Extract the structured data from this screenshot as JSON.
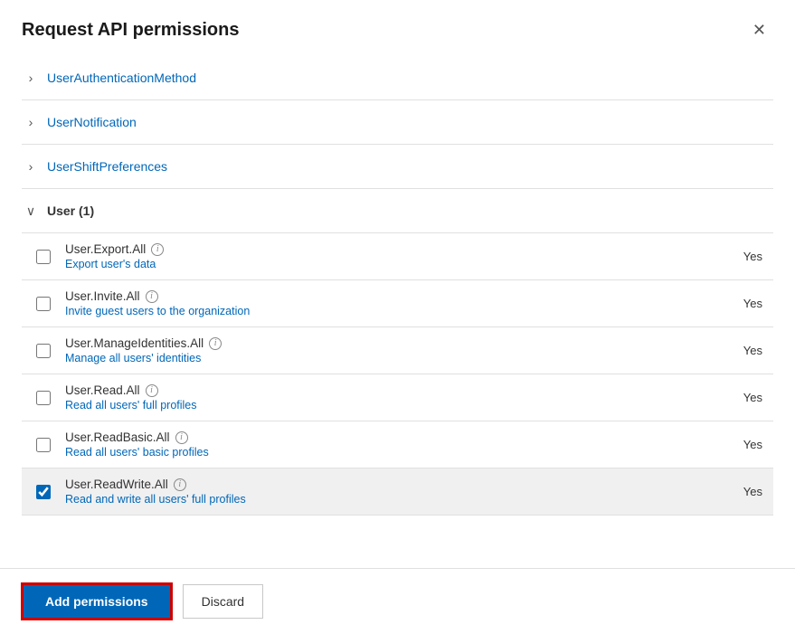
{
  "dialog": {
    "title": "Request API permissions",
    "close_label": "×"
  },
  "sections": [
    {
      "id": "user-authentication-method",
      "label": "UserAuthenticationMethod",
      "expanded": false,
      "chevron": "›"
    },
    {
      "id": "user-notification",
      "label": "UserNotification",
      "expanded": false,
      "chevron": "›"
    },
    {
      "id": "user-shift-preferences",
      "label": "UserShiftPreferences",
      "expanded": false,
      "chevron": "›"
    },
    {
      "id": "user",
      "label": "User (1)",
      "expanded": true,
      "chevron": "∨"
    }
  ],
  "permissions": [
    {
      "id": "user-export-all",
      "name": "User.Export.All",
      "description": "Export user's data",
      "consent": "Yes",
      "checked": false
    },
    {
      "id": "user-invite-all",
      "name": "User.Invite.All",
      "description": "Invite guest users to the organization",
      "consent": "Yes",
      "checked": false
    },
    {
      "id": "user-manage-identities-all",
      "name": "User.ManageIdentities.All",
      "description": "Manage all users' identities",
      "consent": "Yes",
      "checked": false
    },
    {
      "id": "user-read-all",
      "name": "User.Read.All",
      "description": "Read all users' full profiles",
      "consent": "Yes",
      "checked": false
    },
    {
      "id": "user-read-basic-all",
      "name": "User.ReadBasic.All",
      "description": "Read all users' basic profiles",
      "consent": "Yes",
      "checked": false
    },
    {
      "id": "user-readwrite-all",
      "name": "User.ReadWrite.All",
      "description": "Read and write all users' full profiles",
      "consent": "Yes",
      "checked": true
    }
  ],
  "footer": {
    "add_label": "Add permissions",
    "discard_label": "Discard"
  },
  "icons": {
    "info": "i",
    "close": "✕"
  }
}
